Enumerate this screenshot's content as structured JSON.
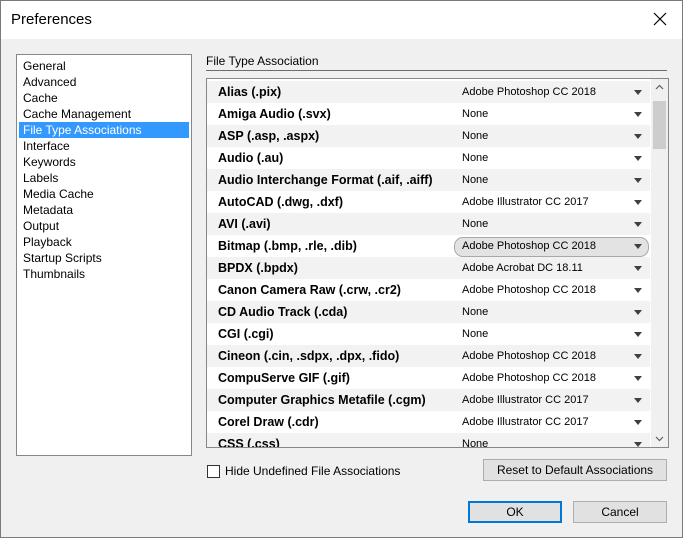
{
  "window": {
    "title": "Preferences"
  },
  "categories": [
    {
      "label": "General"
    },
    {
      "label": "Advanced"
    },
    {
      "label": "Cache"
    },
    {
      "label": "Cache Management"
    },
    {
      "label": "File Type Associations",
      "selected": true
    },
    {
      "label": "Interface"
    },
    {
      "label": "Keywords"
    },
    {
      "label": "Labels"
    },
    {
      "label": "Media Cache"
    },
    {
      "label": "Metadata"
    },
    {
      "label": "Output"
    },
    {
      "label": "Playback"
    },
    {
      "label": "Startup Scripts"
    },
    {
      "label": "Thumbnails"
    }
  ],
  "section": {
    "title": "File Type Association"
  },
  "associations": [
    {
      "type": "Alias (.pix)",
      "app": "Adobe Photoshop CC 2018"
    },
    {
      "type": "Amiga Audio (.svx)",
      "app": "None"
    },
    {
      "type": "ASP (.asp, .aspx)",
      "app": "None"
    },
    {
      "type": "Audio (.au)",
      "app": "None"
    },
    {
      "type": "Audio Interchange Format (.aif, .aiff)",
      "app": "None"
    },
    {
      "type": "AutoCAD (.dwg, .dxf)",
      "app": "Adobe Illustrator CC 2017"
    },
    {
      "type": "AVI (.avi)",
      "app": "None"
    },
    {
      "type": "Bitmap (.bmp, .rle, .dib)",
      "app": "Adobe Photoshop CC 2018",
      "active": true
    },
    {
      "type": "BPDX (.bpdx)",
      "app": "Adobe Acrobat DC 18.11"
    },
    {
      "type": "Canon Camera Raw (.crw, .cr2)",
      "app": "Adobe Photoshop CC 2018"
    },
    {
      "type": "CD Audio Track (.cda)",
      "app": "None"
    },
    {
      "type": "CGI (.cgi)",
      "app": "None"
    },
    {
      "type": "Cineon (.cin, .sdpx, .dpx, .fido)",
      "app": "Adobe Photoshop CC 2018"
    },
    {
      "type": "CompuServe GIF (.gif)",
      "app": "Adobe Photoshop CC 2018"
    },
    {
      "type": "Computer Graphics Metafile (.cgm)",
      "app": "Adobe Illustrator CC 2017"
    },
    {
      "type": "Corel Draw (.cdr)",
      "app": "Adobe Illustrator CC 2017"
    },
    {
      "type": "CSS (.css)",
      "app": "None"
    }
  ],
  "controls": {
    "hide_label": "Hide Undefined File Associations",
    "hide_checked": false,
    "reset_label": "Reset to Default Associations",
    "ok_label": "OK",
    "cancel_label": "Cancel"
  },
  "colors": {
    "selection": "#3399ff",
    "default_button_border": "#0078d7"
  }
}
